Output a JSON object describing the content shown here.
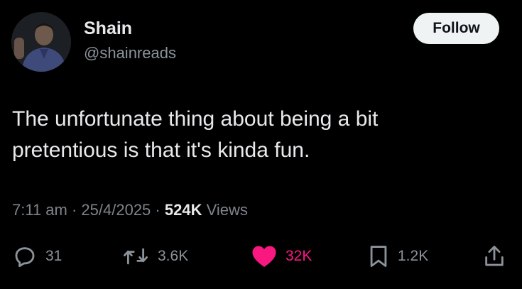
{
  "author": {
    "name": "Shain",
    "handle": "@shainreads"
  },
  "follow_label": "Follow",
  "tweet": {
    "line1": "The unfortunate thing about being a bit",
    "line2": "pretentious is that it's kinda fun."
  },
  "meta": {
    "time": "7:11 am",
    "separator": " · ",
    "date": "25/4/2025",
    "views_count": "524K",
    "views_label": "Views"
  },
  "actions": {
    "replies": "31",
    "retweets": "3.6K",
    "likes": "32K",
    "bookmarks": "1.2K"
  },
  "colors": {
    "background": "#000000",
    "like_active": "#f91880",
    "muted": "#8b9299",
    "text": "#e7e9ea"
  },
  "icons": {
    "reply": "reply-icon",
    "retweet": "retweet-icon",
    "like": "heart-icon",
    "bookmark": "bookmark-icon",
    "share": "share-icon"
  }
}
